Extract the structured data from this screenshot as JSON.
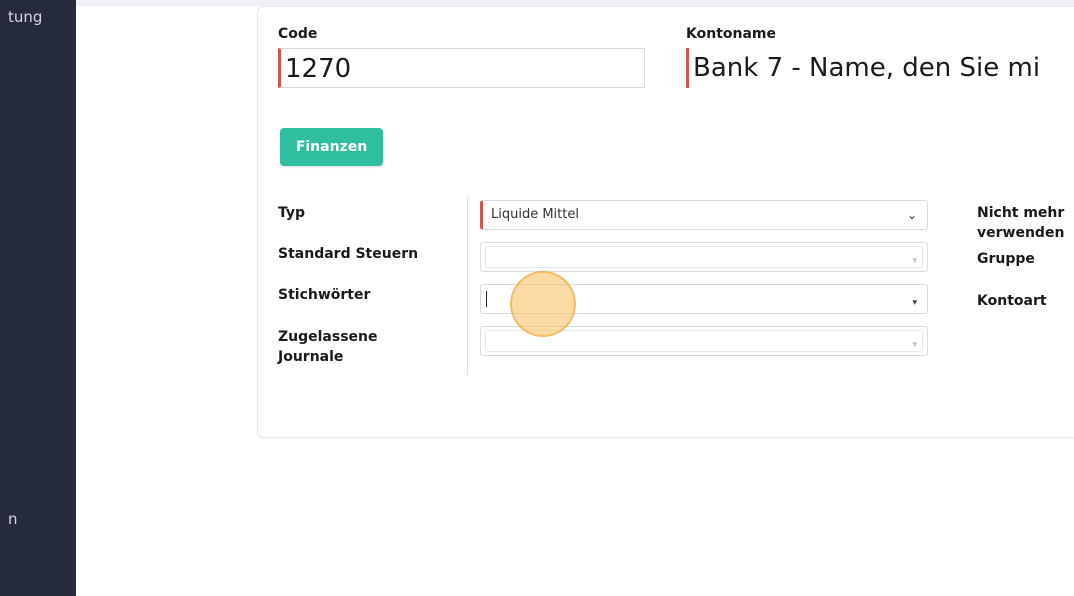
{
  "sidebar": {
    "fragment_top": "tung",
    "fragment_bottom": "n"
  },
  "form": {
    "code_label": "Code",
    "code_value": "1270",
    "name_label": "Kontoname",
    "name_value": "Bank 7 - Name, den Sie mi",
    "tag_button": "Finanzen",
    "typ_label": "Typ",
    "typ_value": "Liquide Mittel",
    "taxes_label": "Standard Steuern",
    "taxes_value": "",
    "keywords_label": "Stichwörter",
    "keywords_value": "",
    "journals_label": "Zugelassene Journale",
    "journals_value": "",
    "deprecated_label": "Nicht mehr verwenden",
    "group_label": "Gruppe",
    "account_type_label": "Kontoart"
  },
  "icons": {
    "select_chevron": "chevron-down-icon",
    "select_caret": "caret-down-icon"
  },
  "colors": {
    "sidebar": "#252a3d",
    "accent_button": "#2fbf9f",
    "required_marker": "#d9534f",
    "click_highlight": "#f5be5a"
  }
}
